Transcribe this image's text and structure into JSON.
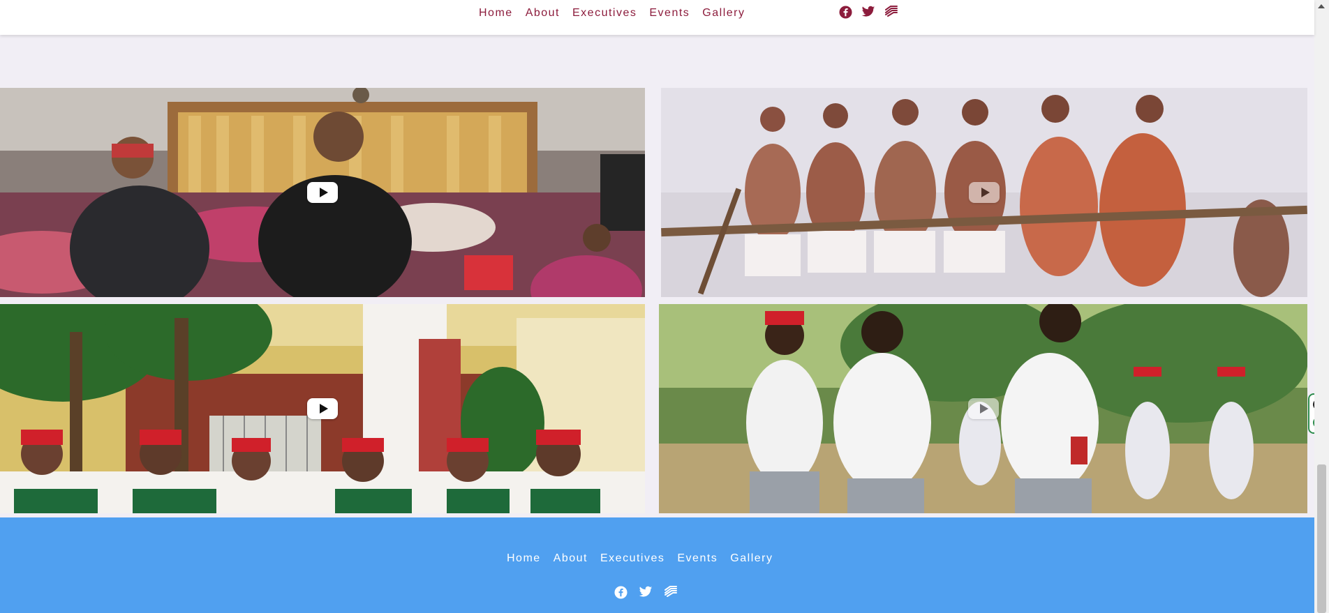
{
  "nav": {
    "links": [
      "Home",
      "About",
      "Executives",
      "Events",
      "Gallery"
    ],
    "social_icons": [
      "facebook-icon",
      "twitter-icon",
      "layers-icon"
    ]
  },
  "gallery": {
    "videos": [
      {
        "scene": "celebration hall, man singing with microphone"
      },
      {
        "scene": "traditional dancers in red attire"
      },
      {
        "scene": "men in red caps seated before yellow house"
      },
      {
        "scene": "dancers in white shirts in green landscape"
      }
    ],
    "play_icon": "play-icon"
  },
  "footer": {
    "links": [
      "Home",
      "About",
      "Executives",
      "Events",
      "Gallery"
    ],
    "social_icons": [
      "facebook-icon",
      "twitter-icon",
      "layers-icon"
    ]
  },
  "colors": {
    "nav_link": "#8c1c3c",
    "footer_bg": "#50a0f0",
    "page_bg": "#f1eef5"
  }
}
